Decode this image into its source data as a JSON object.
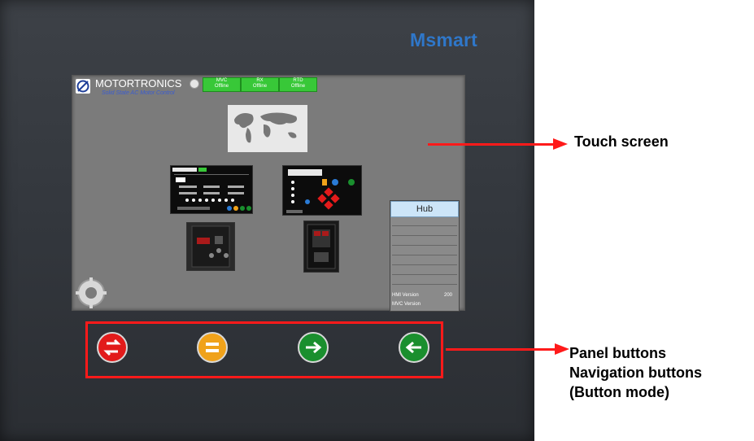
{
  "device": {
    "brand": "Msmart"
  },
  "screen": {
    "logo_text": "MOTORTRONICS",
    "logo_sub": "Solid State AC Motor Control",
    "statuses": [
      {
        "name": "MVC",
        "state": "Offline"
      },
      {
        "name": "RX",
        "state": "Offline"
      },
      {
        "name": "RTD",
        "state": "Offline"
      }
    ],
    "hub": {
      "title": "Hub",
      "hmi_label": "HMI Version",
      "hmi_value": "200",
      "mvc_label": "MVC Version",
      "mvc_value": ""
    }
  },
  "annotations": {
    "touch_screen": "Touch screen",
    "panel_buttons": "Panel buttons",
    "navigation_buttons": "Navigation buttons",
    "button_mode": "(Button mode)"
  },
  "buttons": [
    {
      "name": "refresh",
      "color": "#e21b1b"
    },
    {
      "name": "menu",
      "color": "#f0a21a"
    },
    {
      "name": "next",
      "color": "#1a8f2e"
    },
    {
      "name": "back",
      "color": "#1a8f2e"
    }
  ]
}
